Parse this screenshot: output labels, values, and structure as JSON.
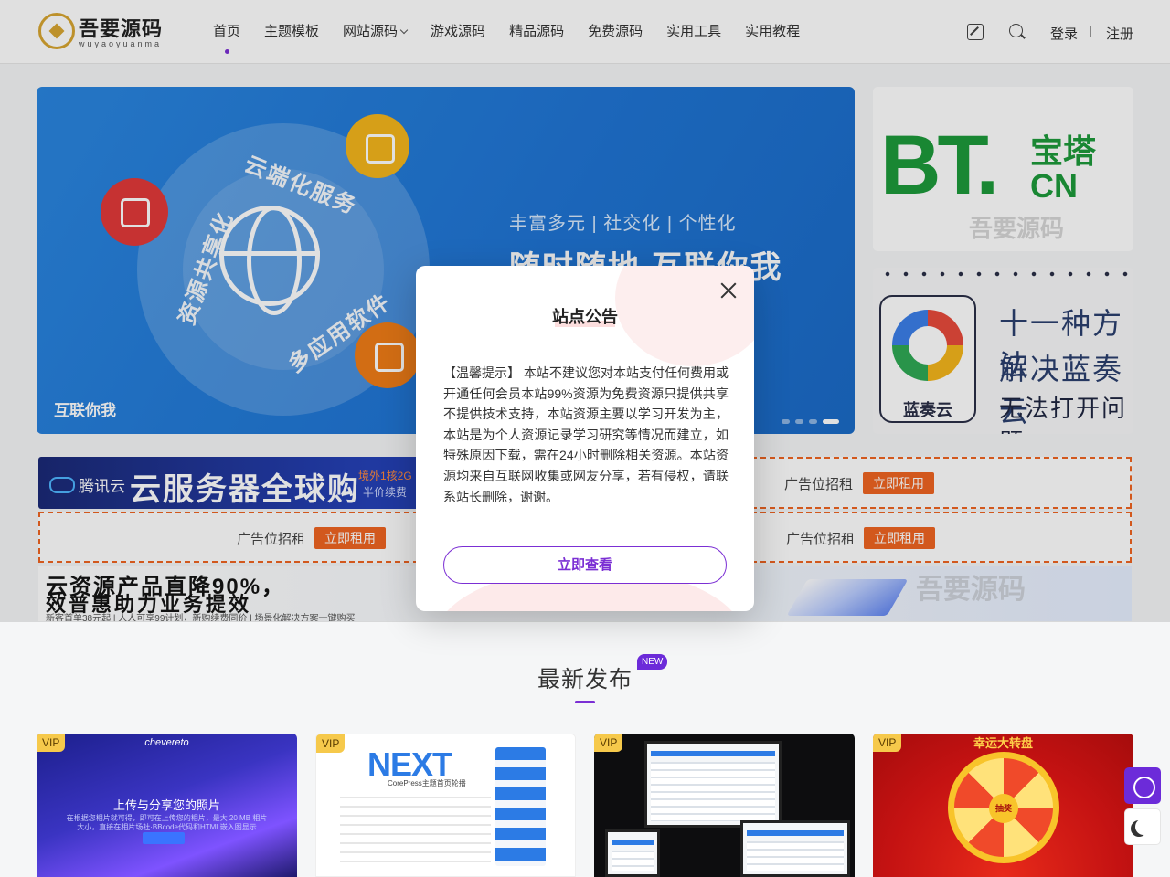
{
  "header": {
    "logo_title": "吾要源码",
    "logo_sub": "wuyaoyuanma",
    "nav": [
      {
        "label": "首页"
      },
      {
        "label": "主题模板"
      },
      {
        "label": "网站源码"
      },
      {
        "label": "游戏源码"
      },
      {
        "label": "精品源码"
      },
      {
        "label": "免费源码"
      },
      {
        "label": "实用工具"
      },
      {
        "label": "实用教程"
      }
    ],
    "active_nav": "首页",
    "login_label": "登录",
    "register_label": "注册",
    "icons": [
      "edit-icon",
      "search-icon"
    ]
  },
  "hero": {
    "arc_1": "云端化服务",
    "arc_2": "资源共享化",
    "arc_3": "多应用软件",
    "tagline": "丰富多元 | 社交化 | 个性化",
    "headline": "随时随地 互联你我",
    "caption": "互联你我",
    "slide_count": 4,
    "active_slide": 4
  },
  "side_banners": {
    "bt_logo": "BT.",
    "bt_cn_1": "宝塔",
    "bt_cn_2": "CN",
    "bt_watermark": "吾要源码",
    "lz_name": "蓝奏云",
    "lz_line_1": "十一种方法",
    "lz_line_2": "解决蓝奏云",
    "lz_line_3": "无法打开问题"
  },
  "ads": {
    "tencent_logo": "腾讯云",
    "tencent_title": "云服务器全球购",
    "tencent_sub_1": "境外1核2G",
    "tencent_sub_2": "半价续费",
    "slot_label": "广告位招租",
    "slot_button": "立即租用",
    "banner2_line_1": "云资源产品直降90%，",
    "banner2_line_2": "效普惠助力业务提效",
    "banner2_line_3": "新客首单38元起 | 人人可享99计划，新购续费同价 | 场景化解决方案一键购买",
    "banner2_watermark": "吾要源码"
  },
  "section": {
    "title": "最新发布",
    "badge": "NEW"
  },
  "cards": [
    {
      "badge": "VIP",
      "brand": "chevereto",
      "title": "上传与分享您的照片",
      "desc": "在根据您相片就可得，即可在上传您的相片，最大 20 MB 相片大小，直接在相片场社·BBcode代码和HTML嵌入图显示"
    },
    {
      "badge": "VIP",
      "logo": "NEXT",
      "sub": "CorePress主题首页轮播"
    },
    {
      "badge": "VIP"
    },
    {
      "badge": "VIP",
      "title": "幸运大转盘",
      "center": "抽奖"
    }
  ],
  "floating": [
    "chat-icon",
    "moon-icon"
  ],
  "modal": {
    "title": "站点公告",
    "body": "【温馨提示】 本站不建议您对本站支付任何费用或开通任何会员本站99%资源为免费资源只提供共享不提供技术支持，本站资源主要以学习开发为主，本站是为个人资源记录学习研究等情况而建立，如特殊原因下载，需在24小时删除相关资源。本站资源均来自互联网收集或网友分享，若有侵权，请联系站长删除，谢谢。",
    "button": "立即查看"
  },
  "colors": {
    "accent": "#7b2fd4",
    "ad_orange": "#f06522",
    "vip_gold": "#f6c94b"
  }
}
